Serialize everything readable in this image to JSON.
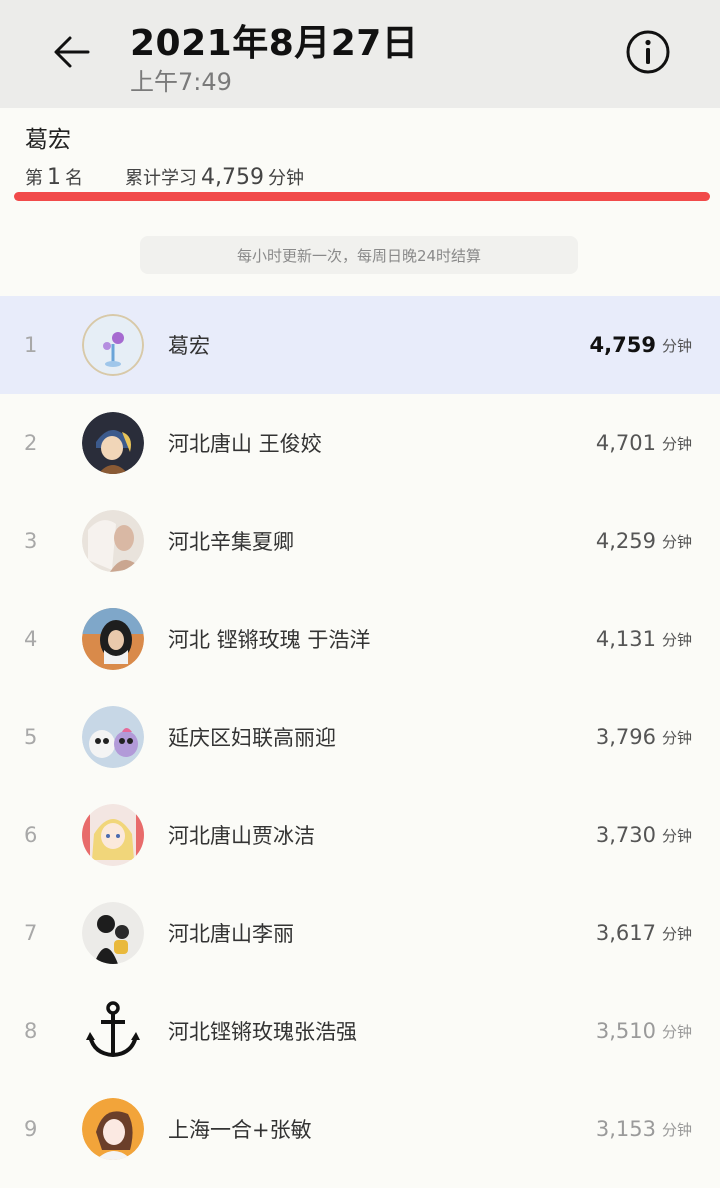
{
  "header": {
    "title": "2021年8月27日",
    "subtitle": "上午7:49"
  },
  "me": {
    "name": "葛宏",
    "rank_prefix": "第",
    "rank": "1",
    "rank_suffix": "名",
    "total_label": "累计学习",
    "total": "4,759",
    "total_unit": "分钟"
  },
  "notice": "每小时更新一次，每周日晚24时结算",
  "unit": "分钟",
  "rows": [
    {
      "rank": "1",
      "name": "葛宏",
      "score": "4,759"
    },
    {
      "rank": "2",
      "name": "河北唐山 王俊姣",
      "score": "4,701"
    },
    {
      "rank": "3",
      "name": "河北辛集夏卿",
      "score": "4,259"
    },
    {
      "rank": "4",
      "name": "河北 铿锵玫瑰 于浩洋",
      "score": "4,131"
    },
    {
      "rank": "5",
      "name": "延庆区妇联高丽迎",
      "score": "3,796"
    },
    {
      "rank": "6",
      "name": "河北唐山贾冰洁",
      "score": "3,730"
    },
    {
      "rank": "7",
      "name": "河北唐山李丽",
      "score": "3,617"
    },
    {
      "rank": "8",
      "name": "河北铿锵玫瑰张浩强",
      "score": "3,510"
    },
    {
      "rank": "9",
      "name": "上海一合+张敏",
      "score": "3,153"
    }
  ],
  "icons": {
    "back": "arrow-left-icon",
    "info": "info-circle-icon",
    "anchor": "anchor-icon"
  },
  "colors": {
    "highlight_row": "#e8ecfa",
    "underline": "#f03b3b"
  }
}
